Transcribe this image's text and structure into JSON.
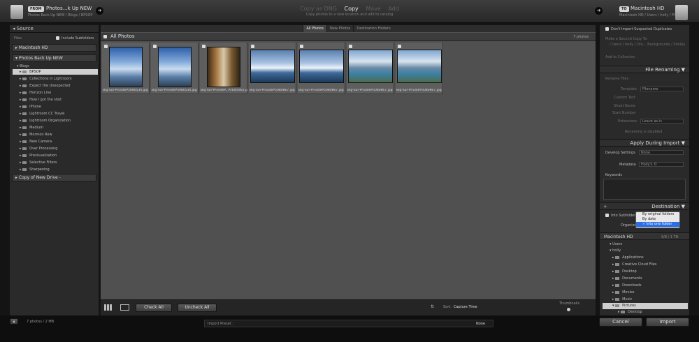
{
  "header": {
    "from_tag": "FROM",
    "source_name": "Photos…k Up NEW",
    "source_path": "Photos Back Up NEW / Blogs / BPSOP",
    "modes": [
      "Copy as DNG",
      "Copy",
      "Move",
      "Add"
    ],
    "selected_mode": "Copy",
    "mode_description": "Copy photos to a new location and add to catalog",
    "to_tag": "TO",
    "dest_name": "Macintosh HD",
    "dest_path": "Macintosh HD / Users / holly / Pictures"
  },
  "source_panel": {
    "title": "Source",
    "files_label": "Files",
    "include_subfolders": "Include Subfolders",
    "devices": [
      "Macintosh HD",
      "Photos Back Up NEW"
    ],
    "parent_folder": "Blogs",
    "selected_folder": "BPSOP",
    "folders": [
      "Collections in Lightroom",
      "Expect the Unexpected",
      "Horizon Line",
      "How I got the shot",
      "iPhone",
      "Lightroom CC Travel",
      "Lightroom Organization",
      "Medium",
      "Mormon Row",
      "New Camera",
      "Over Processing",
      "Previsualization",
      "Selective Filters",
      "Sharpening"
    ],
    "extra_device": "Copy of New Drive -"
  },
  "grid": {
    "tabs": [
      "All Photos",
      "New Photos",
      "Destination Folders"
    ],
    "selected_tab": "All Photos",
    "title": "All Photos",
    "count_label": "7 photos",
    "thumbnails": [
      {
        "caption": "Big-Sur-PrivateP5080534.jpg",
        "kind": "sky"
      },
      {
        "caption": "Big-Sur-PrivateP5080534.jpg",
        "kind": "sky"
      },
      {
        "caption": "Big-Sur-PrivateP...ArtistAsk2.jpg",
        "kind": "forest"
      },
      {
        "caption": "Big-Sur-PrivateP5080867.jpg",
        "kind": "wave"
      },
      {
        "caption": "Big-Sur-PrivateP5080867.jpg",
        "kind": "wave"
      },
      {
        "caption": "Big-Sur-PrivateP5080867.jpg",
        "kind": "coast"
      },
      {
        "caption": "Big-Sur-PrivateP5080867.jpg",
        "kind": "coast"
      }
    ],
    "check_all": "Check All",
    "uncheck_all": "Uncheck All",
    "sort_label": "Sort:",
    "sort_value": "Capture Time",
    "thumbnails_label": "Thumbnails"
  },
  "right_panel": {
    "dont_import_dupes": "Don't Import Suspected Duplicates",
    "second_copy": "Make a Second Copy To:",
    "second_copy_path": "/ Users / holly / Dro... Backgrounds / Smiley",
    "add_to_collection": "Add to Collection",
    "file_renaming_title": "File Renaming",
    "rename_files": "Rename Files",
    "template_label": "Template",
    "template_value": "Filename",
    "custom_text_label": "Custom Text",
    "shoot_name_label": "Shoot Name",
    "start_number_label": "Start Number",
    "extensions_label": "Extensions",
    "extensions_value": "Leave as-is",
    "renaming_disabled": "Renaming is disabled",
    "apply_title": "Apply During Import",
    "develop_label": "Develop Settings",
    "develop_value": "None",
    "metadata_label": "Metadata",
    "metadata_value": "Holly's ©",
    "keywords_label": "Keywords",
    "destination_title": "Destination",
    "into_subfolder": "Into Subfolder",
    "organize_label": "Organize",
    "organize_options": [
      "By original folders",
      "By date",
      "Into one folder"
    ],
    "organize_selected": "Into one folder",
    "volume_name": "Macintosh HD",
    "volume_space": "9/8 / 1 TB",
    "users": "Users",
    "holly": "holly",
    "dest_folders": [
      "Applications",
      "Creative Cloud Files",
      "Desktop",
      "Documents",
      "Downloads",
      "Movies",
      "Music"
    ],
    "selected_folder": "Pictures",
    "child_folder": "Desktop"
  },
  "footer": {
    "info": "7 photos / 2 MB",
    "preset_label": "Import Preset :",
    "preset_value": "None",
    "cancel": "Cancel",
    "import": "Import"
  }
}
